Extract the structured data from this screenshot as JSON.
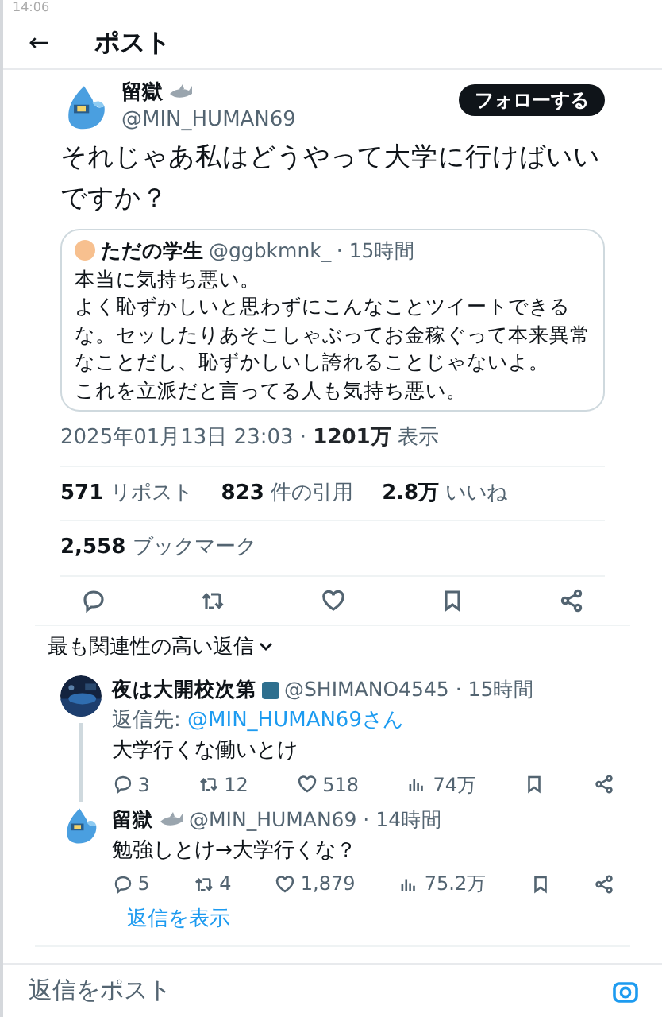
{
  "status_bar": {
    "time": "14:06"
  },
  "header": {
    "back": "←",
    "title": "ポスト"
  },
  "post": {
    "name": "留獄",
    "handle": "@MIN_HUMAN69",
    "follow": "フォローする",
    "text": "それじゃあ私はどうやって大学に行けばいいですか？",
    "quote": {
      "name": "ただの学生",
      "handle": "@ggbkmnk_",
      "time": "· 15時間",
      "lines": [
        "本当に気持ち悪い。",
        "よく恥ずかしいと思わずにこんなことツイートできるな。セッしたりあそこしゃぶってお金稼ぐって本来異常なことだし、恥ずかしいし誇れることじゃないよ。",
        "これを立派だと言ってる人も気持ち悪い。"
      ]
    },
    "date": "2025年01月13日 23:03 ·",
    "views": "1201万",
    "views_label": "表示",
    "stats": [
      "**571** リポスト",
      "**823** 件の引用",
      "**2.8万** いいね"
    ],
    "bookmarks": "**2,558** ブックマーク"
  },
  "sort": {
    "label": "最も関連性の高い返信"
  },
  "replies": [
    {
      "name": "夜は大開校次第",
      "handle": "@SHIMANO4545 · 15時間",
      "reply_to_label": "返信先:",
      "reply_to": "@MIN_HUMAN69さん",
      "text": "大学行くな働いとけ",
      "counts": [
        "3",
        "12",
        "518",
        "74万"
      ]
    },
    {
      "name": "留獄",
      "handle": "@MIN_HUMAN69 · 14時間",
      "text": "勉強しとけ→大学行くな？",
      "kind": "mascot",
      "counts": [
        "5",
        "4",
        "1,879",
        "75.2万"
      ]
    }
  ],
  "show_replies": "返信を表示",
  "compose": {
    "placeholder": "返信をポスト"
  }
}
